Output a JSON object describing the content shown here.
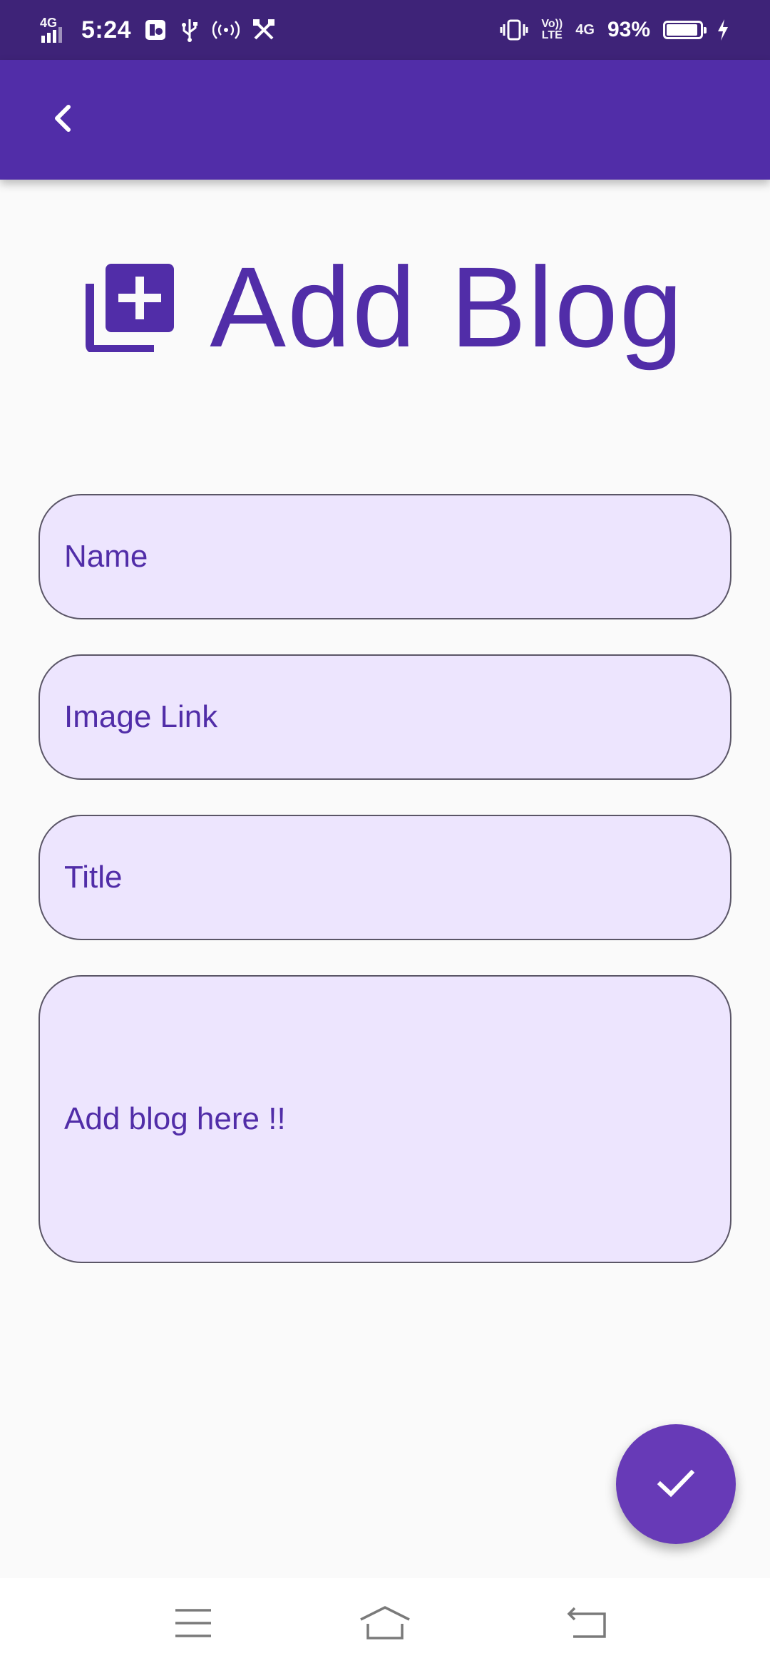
{
  "status_bar": {
    "network": "4G",
    "time": "5:24",
    "volte_top": "Vo))",
    "volte_bottom": "LTE",
    "network2": "4G",
    "battery_percent": "93%",
    "battery_level": 0.93,
    "icons": [
      "signal-icon",
      "app-notification-icon",
      "usb-icon",
      "hotspot-icon",
      "tools-icon",
      "vibrate-icon",
      "volte-icon",
      "signal-4g-icon",
      "battery-icon",
      "charging-icon"
    ]
  },
  "app_bar": {
    "back_icon": "chevron-left-icon",
    "color": "#512da8"
  },
  "header": {
    "icon": "library-add-icon",
    "title": "Add Blog"
  },
  "form": {
    "name_label": "Name",
    "image_link_label": "Image Link",
    "title_label": "Title",
    "blog_label": "Add blog here !!"
  },
  "fab": {
    "icon": "check-icon",
    "color": "#673ab7"
  },
  "nav_bar": {
    "icons": [
      "menu-icon",
      "home-icon",
      "back-icon"
    ]
  },
  "colors": {
    "primary": "#512da8",
    "status_bar": "#3e2378",
    "field_fill": "#ede5fe",
    "field_border": "#5a5566",
    "background": "#fafafa"
  }
}
